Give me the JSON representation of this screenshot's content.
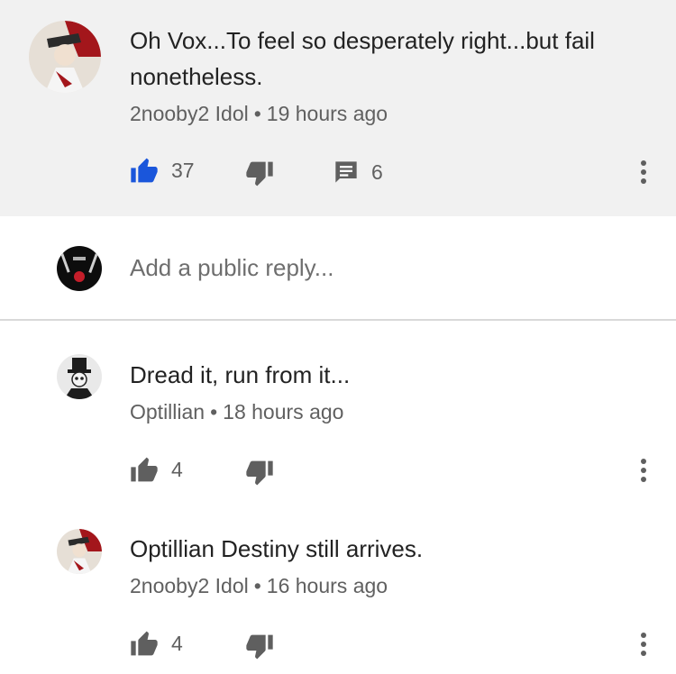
{
  "main_comment": {
    "avatar_icon": "user-avatar-icon",
    "text": "Oh Vox...To feel so desperately right...but fail nonetheless.",
    "author": "2nooby2 Idol",
    "separator": "•",
    "time": "19 hours ago",
    "likes": "37",
    "replies": "6",
    "like_active_color": "#1a56db"
  },
  "reply_box": {
    "placeholder": "Add a public reply..."
  },
  "replies": [
    {
      "text": "Dread it, run from it...",
      "author": "Optillian",
      "separator": "•",
      "time": "18 hours ago",
      "likes": "4"
    },
    {
      "text": "Optillian Destiny still arrives.",
      "author": "2nooby2 Idol",
      "separator": "•",
      "time": "16 hours ago",
      "likes": "4"
    }
  ],
  "colors": {
    "highlight_bg": "#f1f1f1",
    "secondary_text": "#606060",
    "icon_gray": "#5f5f5f"
  }
}
